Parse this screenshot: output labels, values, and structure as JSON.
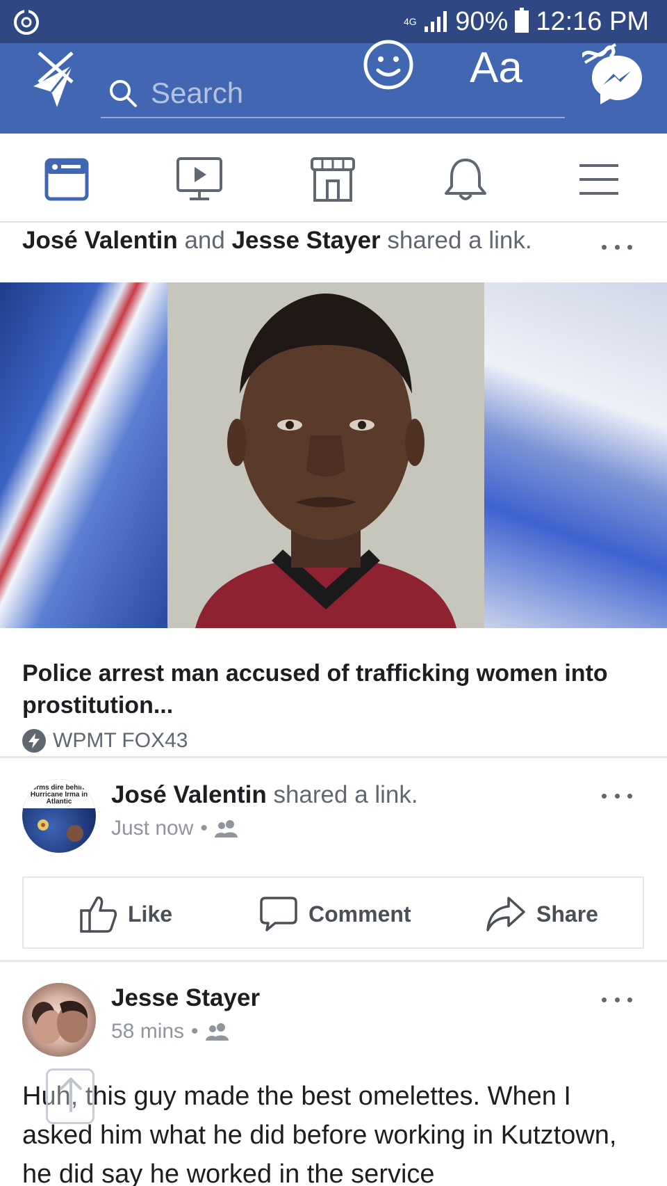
{
  "status_bar": {
    "data_indicator": "4G",
    "battery": "90%",
    "time": "12:16 PM"
  },
  "header": {
    "search_placeholder": "Search",
    "text_tool_label": "Aa"
  },
  "nav_tabs": [
    "news-feed",
    "watch",
    "marketplace",
    "notifications",
    "menu"
  ],
  "post1": {
    "actor1": "José Valentin",
    "joiner": "and",
    "actor2": "Jesse Stayer",
    "action": "shared a link.",
    "link_title": "Police arrest man accused of trafficking women into prostitution...",
    "source": "WPMT FOX43"
  },
  "post2": {
    "avatar_caption": "forms dire behind Hurricane Irma in Atlantic",
    "author": "José Valentin",
    "action": "shared a link.",
    "time": "Just now",
    "audience_icon": "friends-icon",
    "like_label": "Like",
    "comment_label": "Comment",
    "share_label": "Share"
  },
  "post3": {
    "author": "Jesse Stayer",
    "time": "58 mins",
    "audience_icon": "friends-icon",
    "text": "Huh, this guy made the best omelettes. When I asked him what he did before working in Kutztown, he did say he worked in the service"
  },
  "colors": {
    "status_bar": "#2f4783",
    "header": "#4267b2",
    "accent": "#4267b2",
    "muted_text": "#606770"
  }
}
